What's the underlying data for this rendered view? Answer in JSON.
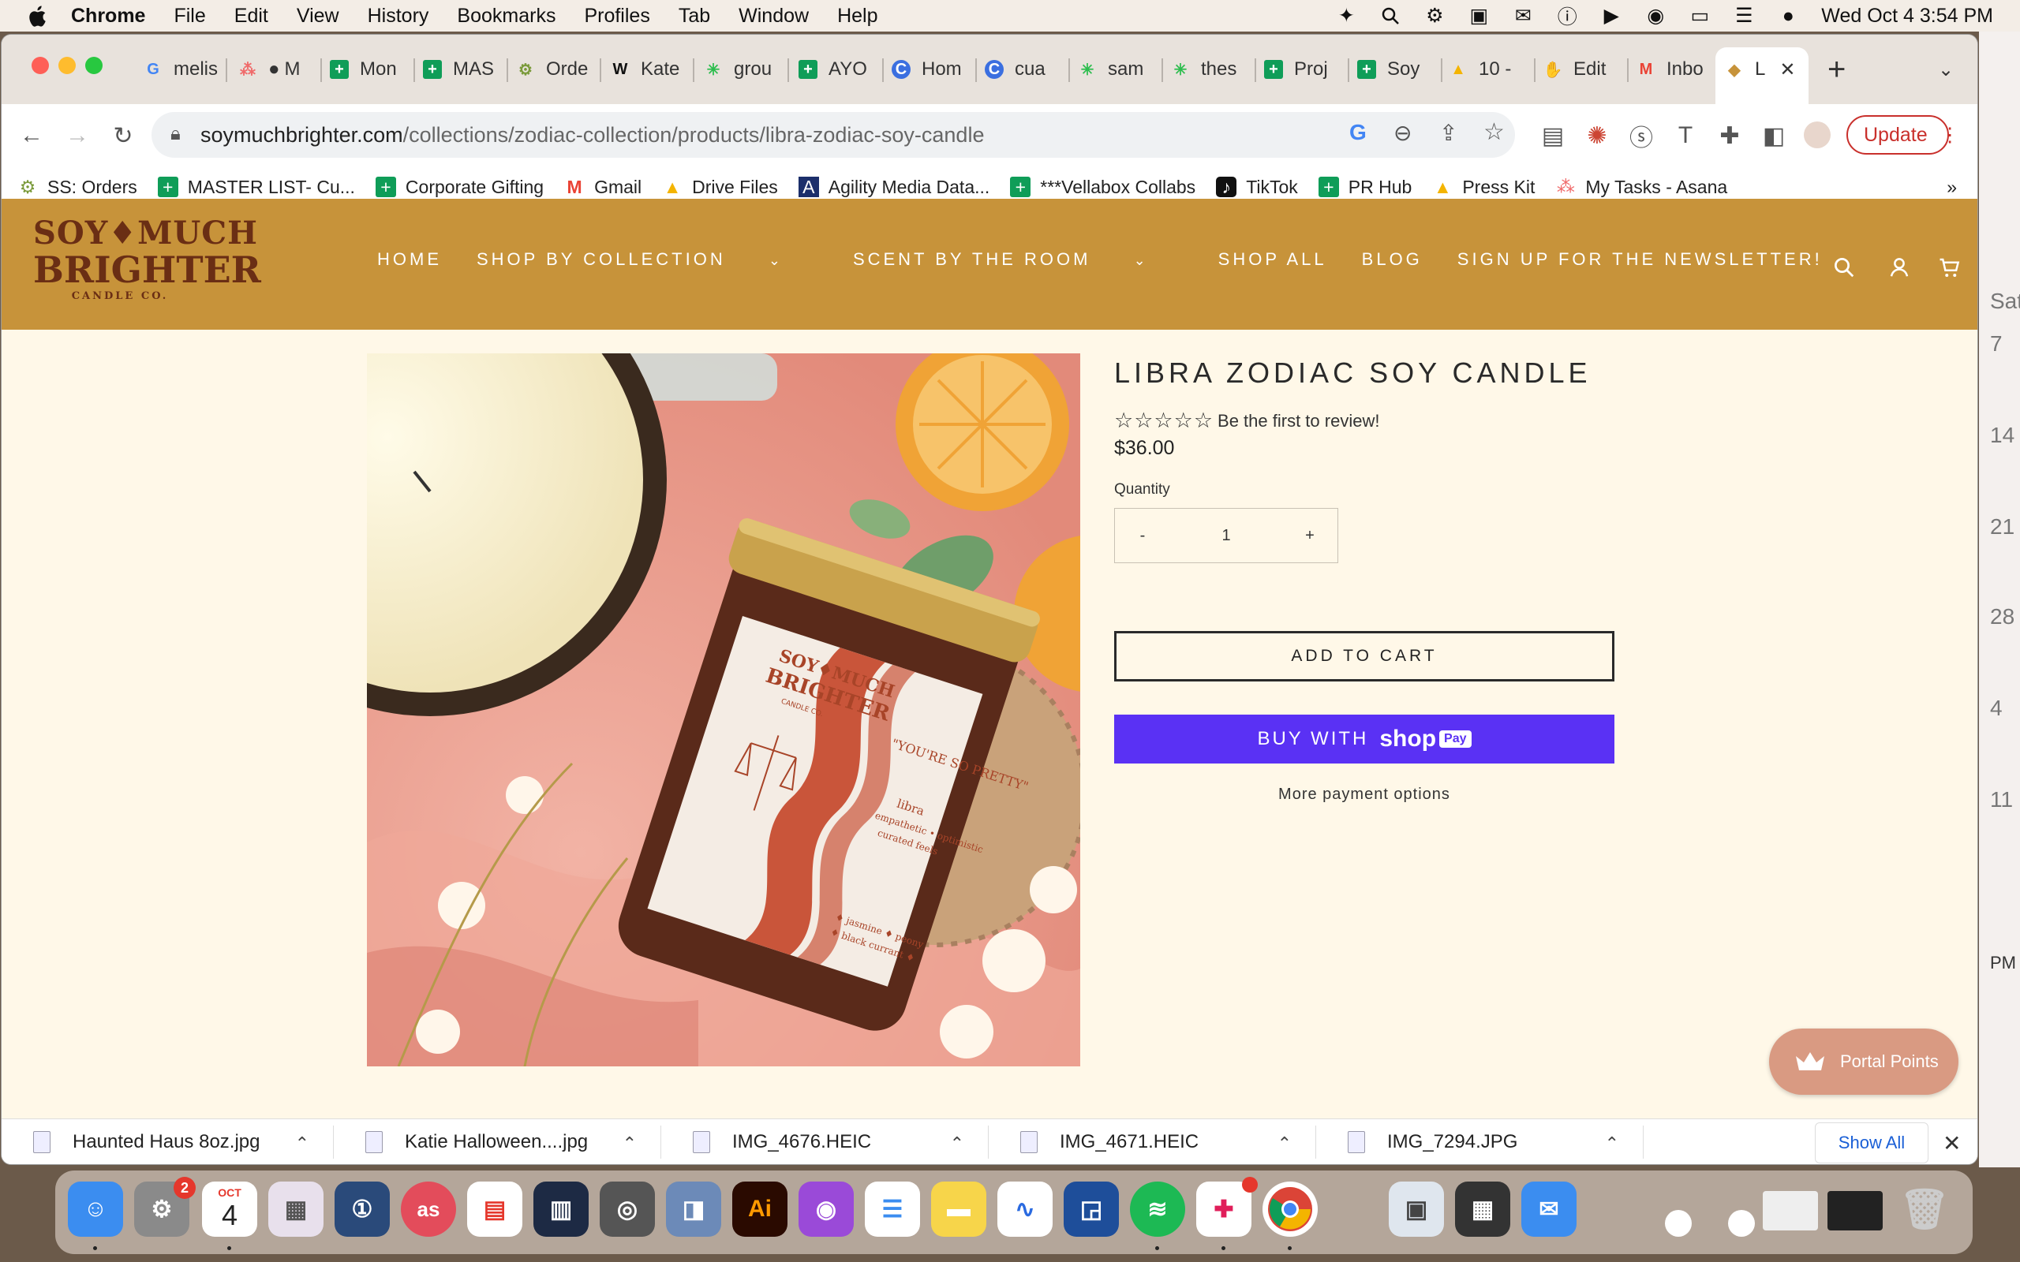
{
  "menubar": {
    "app": "Chrome",
    "items": [
      "File",
      "Edit",
      "View",
      "History",
      "Bookmarks",
      "Profiles",
      "Tab",
      "Window",
      "Help"
    ],
    "clock": "Wed Oct 4  3:54 PM"
  },
  "tabs": [
    "melis",
    "M",
    "Mon",
    "MAS",
    "Orde",
    "Kate",
    "grou",
    "AYO",
    "Hom",
    "cua",
    "sam",
    "thes",
    "Proj",
    "Soy",
    "10 -",
    "Edit",
    "Inbo",
    "L"
  ],
  "address_bar": {
    "domain": "soymuchbrighter.com",
    "path": "/collections/zodiac-collection/products/libra-zodiac-soy-candle",
    "update_label": "Update"
  },
  "bookmarks": [
    "SS: Orders",
    "MASTER LIST- Cu...",
    "Corporate Gifting",
    "Gmail",
    "Drive Files",
    "Agility Media Data...",
    "***Vellabox Collabs",
    "TikTok",
    "PR Hub",
    "Press Kit",
    "My Tasks - Asana"
  ],
  "site": {
    "logo": {
      "line1": "SOY♦MUCH",
      "line2": "BRIGHTER",
      "line3": "CANDLE CO."
    },
    "nav": [
      "HOME",
      "SHOP BY COLLECTION",
      "SCENT BY THE ROOM",
      "SHOP ALL",
      "BLOG",
      "SIGN UP FOR THE NEWSLETTER!"
    ],
    "colors": {
      "header": "#c7933a",
      "page": "#fff8e8",
      "shop_pay": "#5a31f4"
    }
  },
  "product": {
    "title": "LIBRA ZODIAC SOY CANDLE",
    "stars": "☆☆☆☆☆",
    "review_text": "Be the first to review!",
    "price": "$36.00",
    "quantity_label": "Quantity",
    "quantity_minus": "-",
    "quantity": "1",
    "quantity_plus": "+",
    "add_to_cart": "ADD TO CART",
    "buy_with": "BUY WITH",
    "shop_word": "shop",
    "pay_word": "Pay",
    "more_payment": "More payment options",
    "jar_label": {
      "brand1": "SOY♦MUCH",
      "brand2": "BRIGHTER",
      "brand3": "CANDLE CO.",
      "quote": "\"YOU'RE SO PRETTY\"",
      "sign": "libra",
      "traits": "empathetic • optimistic",
      "traits2": "curated feels",
      "notes1": "♦ jasmine ♦ peony",
      "notes2": "♦ black currant ♦"
    }
  },
  "portal": {
    "label": "Portal Points"
  },
  "downloads": {
    "items": [
      "Haunted Haus 8oz.jpg",
      "Katie Halloween....jpg",
      "IMG_4676.HEIC",
      "IMG_4671.HEIC",
      "IMG_7294.JPG"
    ],
    "show_all": "Show All"
  },
  "background_calendar": {
    "weekday": "Sat",
    "dates": [
      "7",
      "14",
      "21",
      "28",
      "4",
      "11"
    ],
    "time": "PM"
  },
  "dock": {
    "calendar_month": "OCT",
    "calendar_day": "4",
    "settings_badge": "2"
  }
}
